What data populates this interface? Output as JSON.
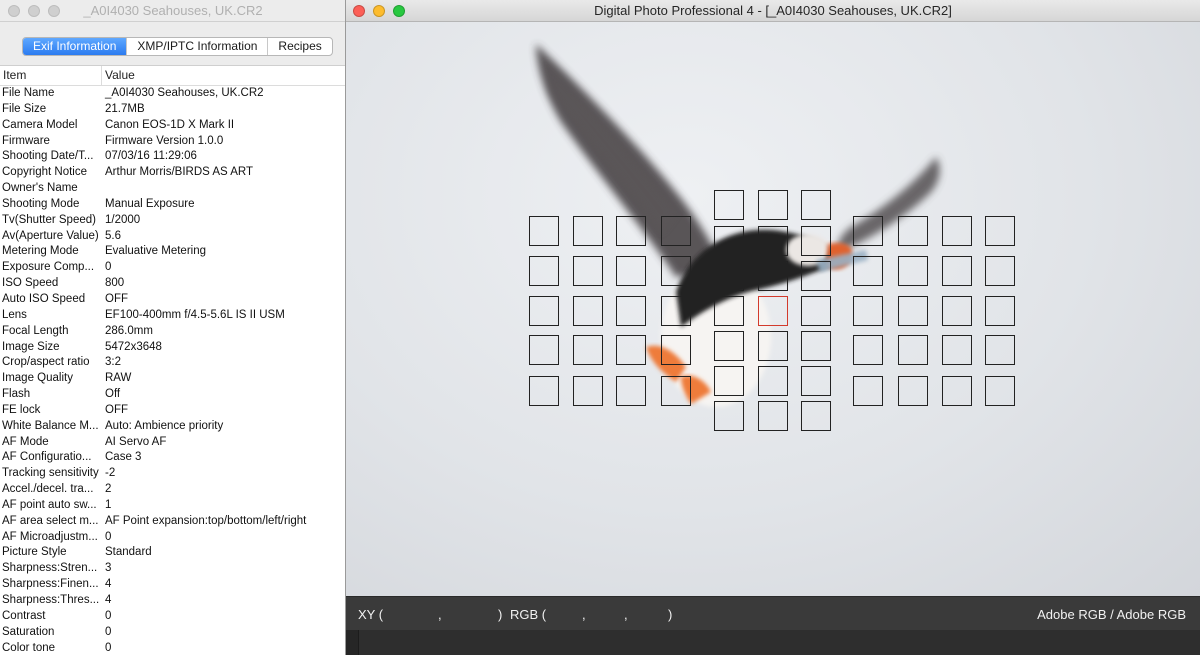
{
  "info_window": {
    "title": "_A0I4030 Seahouses, UK.CR2",
    "tabs": [
      {
        "label": "Exif Information",
        "active": true
      },
      {
        "label": "XMP/IPTC Information",
        "active": false
      },
      {
        "label": "Recipes",
        "active": false
      }
    ],
    "columns": {
      "item": "Item",
      "value": "Value"
    },
    "rows": [
      {
        "item": "File Name",
        "value": "_A0I4030 Seahouses, UK.CR2"
      },
      {
        "item": "File Size",
        "value": "21.7MB"
      },
      {
        "item": "Camera Model",
        "value": "Canon EOS-1D X Mark II"
      },
      {
        "item": "Firmware",
        "value": "Firmware Version 1.0.0"
      },
      {
        "item": "Shooting Date/T...",
        "value": "07/03/16 11:29:06"
      },
      {
        "item": "Copyright Notice",
        "value": "Arthur Morris/BIRDS AS ART"
      },
      {
        "item": "Owner's Name",
        "value": ""
      },
      {
        "item": "Shooting Mode",
        "value": "Manual Exposure"
      },
      {
        "item": "Tv(Shutter Speed)",
        "value": "1/2000"
      },
      {
        "item": "Av(Aperture Value)",
        "value": "5.6"
      },
      {
        "item": "Metering Mode",
        "value": "Evaluative Metering"
      },
      {
        "item": "Exposure Comp...",
        "value": "0"
      },
      {
        "item": "ISO Speed",
        "value": "800"
      },
      {
        "item": "Auto ISO Speed",
        "value": "OFF"
      },
      {
        "item": "Lens",
        "value": "EF100-400mm f/4.5-5.6L IS II USM"
      },
      {
        "item": "Focal Length",
        "value": "286.0mm"
      },
      {
        "item": "Image Size",
        "value": "5472x3648"
      },
      {
        "item": "Crop/aspect ratio",
        "value": "3:2"
      },
      {
        "item": "Image Quality",
        "value": "RAW"
      },
      {
        "item": "Flash",
        "value": "Off"
      },
      {
        "item": "FE lock",
        "value": "OFF"
      },
      {
        "item": "White Balance M...",
        "value": "Auto: Ambience priority"
      },
      {
        "item": "AF Mode",
        "value": "AI Servo AF"
      },
      {
        "item": "AF Configuratio...",
        "value": "Case 3"
      },
      {
        "item": "Tracking sensitivity",
        "value": "-2"
      },
      {
        "item": "Accel./decel. tra...",
        "value": "2"
      },
      {
        "item": "AF point auto sw...",
        "value": "1"
      },
      {
        "item": "AF area select m...",
        "value": "AF Point expansion:top/bottom/left/right"
      },
      {
        "item": "AF Microadjustm...",
        "value": "0"
      },
      {
        "item": "Picture Style",
        "value": "Standard"
      },
      {
        "item": "Sharpness:Stren...",
        "value": "3"
      },
      {
        "item": "Sharpness:Finen...",
        "value": "4"
      },
      {
        "item": "Sharpness:Thres...",
        "value": "4"
      },
      {
        "item": "Contrast",
        "value": "0"
      },
      {
        "item": "Saturation",
        "value": "0"
      },
      {
        "item": "Color tone",
        "value": "0"
      }
    ]
  },
  "main_window": {
    "title": "Digital Photo Professional 4 - [_A0I4030 Seahouses, UK.CR2]",
    "traffic_lights": {
      "close": "#fc5f57",
      "minimize": "#fdbc2e",
      "zoom": "#28c840"
    },
    "af_selected_color": "#d23a2c",
    "status": {
      "xy_label": "XY (",
      "comma1": ",",
      "close_paren": ")",
      "rgb_label": "RGB (",
      "comma2": ",",
      "comma3": ",",
      "close_paren2": ")",
      "color_space": "Adobe RGB / Adobe RGB"
    }
  }
}
